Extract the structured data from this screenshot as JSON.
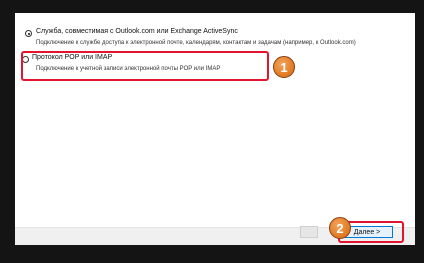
{
  "options": [
    {
      "title": "Служба, совместимая с Outlook.com или Exchange ActiveSync",
      "description": "Подключение к службе доступа к электронной почте, календарям, контактам и задачам (например, к Outlook.com)",
      "selected": true
    },
    {
      "title": "Протокол POP или IMAP",
      "description": "Подключение к учетной записи электронной почты POP или IMAP",
      "selected": false
    }
  ],
  "annotations": {
    "step1": "1",
    "step2": "2",
    "color": "#e3142d"
  },
  "footer": {
    "next_label": "Далее >"
  }
}
